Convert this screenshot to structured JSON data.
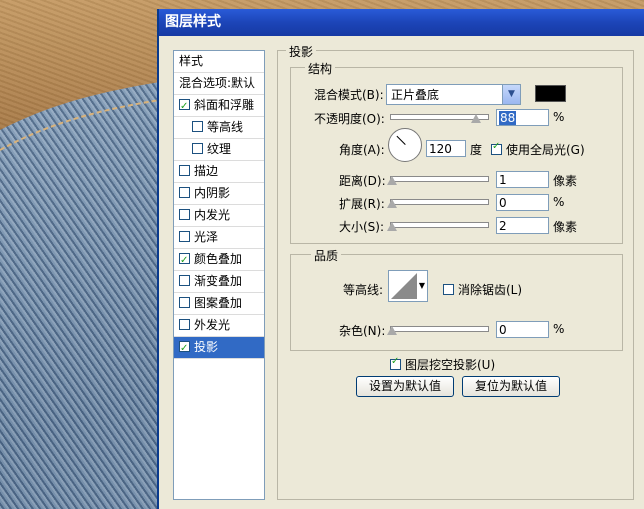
{
  "window": {
    "title": "图层样式"
  },
  "sidebar": {
    "items": [
      {
        "label": "样式",
        "checkbox": false,
        "checked": false,
        "indent": 0
      },
      {
        "label": "混合选项:默认",
        "checkbox": false,
        "checked": false,
        "indent": 0
      },
      {
        "label": "斜面和浮雕",
        "checkbox": true,
        "checked": true,
        "indent": 0
      },
      {
        "label": "等高线",
        "checkbox": true,
        "checked": false,
        "indent": 1
      },
      {
        "label": "纹理",
        "checkbox": true,
        "checked": false,
        "indent": 1
      },
      {
        "label": "描边",
        "checkbox": true,
        "checked": false,
        "indent": 0
      },
      {
        "label": "内阴影",
        "checkbox": true,
        "checked": false,
        "indent": 0
      },
      {
        "label": "内发光",
        "checkbox": true,
        "checked": false,
        "indent": 0
      },
      {
        "label": "光泽",
        "checkbox": true,
        "checked": false,
        "indent": 0
      },
      {
        "label": "颜色叠加",
        "checkbox": true,
        "checked": true,
        "indent": 0
      },
      {
        "label": "渐变叠加",
        "checkbox": true,
        "checked": false,
        "indent": 0
      },
      {
        "label": "图案叠加",
        "checkbox": true,
        "checked": false,
        "indent": 0
      },
      {
        "label": "外发光",
        "checkbox": true,
        "checked": false,
        "indent": 0
      },
      {
        "label": "投影",
        "checkbox": true,
        "checked": true,
        "indent": 0,
        "selected": true
      }
    ]
  },
  "panel": {
    "title": "投影",
    "structure": {
      "title": "结构",
      "blend_mode_label": "混合模式(B):",
      "blend_mode_value": "正片叠底",
      "blend_color": "#000000",
      "opacity_label": "不透明度(O):",
      "opacity_value": "88",
      "opacity_unit": "%",
      "angle_label": "角度(A):",
      "angle_value": "120",
      "angle_unit": "度",
      "global_light_label": "使用全局光(G)",
      "global_light_checked": true,
      "distance_label": "距离(D):",
      "distance_value": "1",
      "distance_unit": "像素",
      "spread_label": "扩展(R):",
      "spread_value": "0",
      "spread_unit": "%",
      "size_label": "大小(S):",
      "size_value": "2",
      "size_unit": "像素"
    },
    "quality": {
      "title": "品质",
      "contour_label": "等高线:",
      "antialias_label": "消除锯齿(L)",
      "antialias_checked": false,
      "noise_label": "杂色(N):",
      "noise_value": "0",
      "noise_unit": "%"
    },
    "knockout_label": "图层挖空投影(U)",
    "knockout_checked": true,
    "set_default_label": "设置为默认值",
    "reset_default_label": "复位为默认值"
  }
}
